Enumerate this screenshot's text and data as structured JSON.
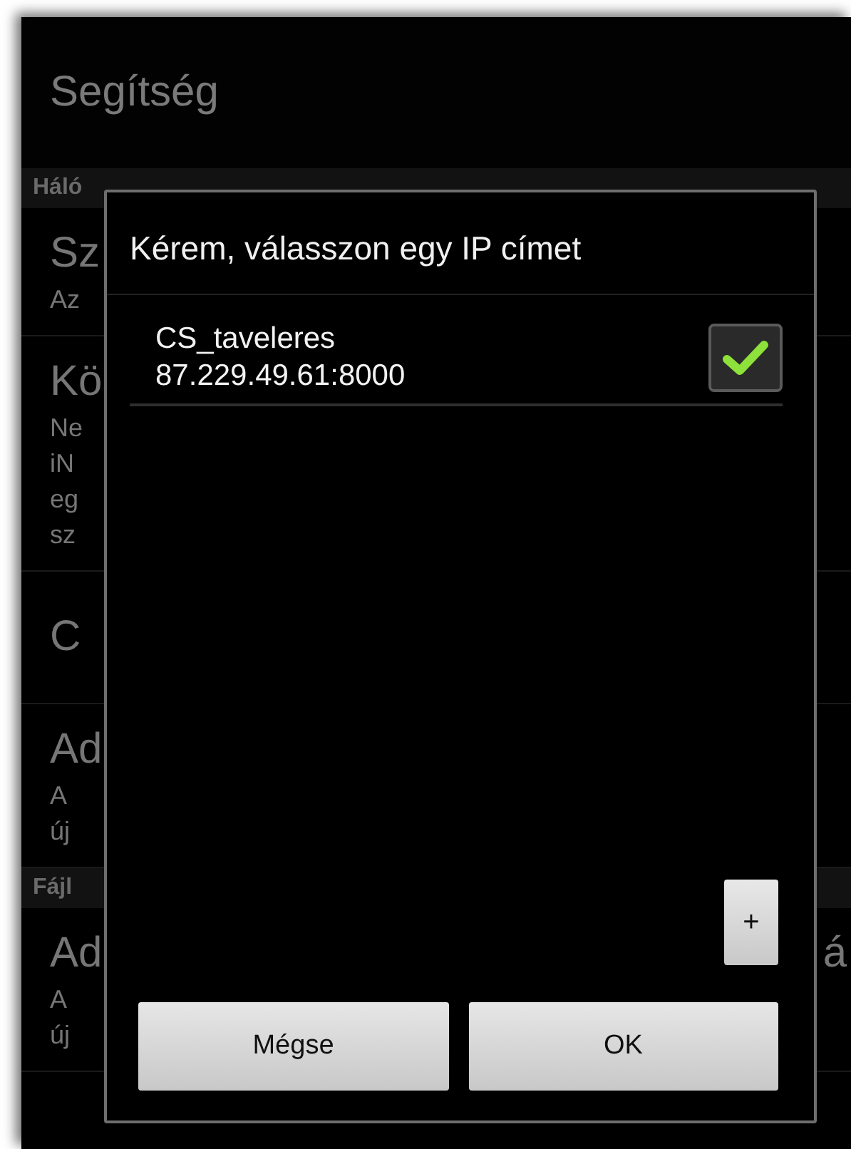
{
  "header": {
    "title": "Segítség"
  },
  "sections": [
    {
      "title": "Háló",
      "items": [
        {
          "title": "Sz",
          "summary": [
            "Az"
          ]
        },
        {
          "title": "Kö",
          "summary": [
            "Ne",
            "iN",
            "eg",
            "sz"
          ]
        },
        {
          "title": "C"
        },
        {
          "title": "Ad",
          "summary": [
            "A",
            "új"
          ]
        }
      ]
    },
    {
      "title": "Fájl",
      "items": [
        {
          "title": "Ad",
          "title_end": "á",
          "summary": [
            "A",
            "új"
          ]
        }
      ]
    }
  ],
  "dialog": {
    "title": "Kérem, válasszon egy IP címet",
    "options": [
      {
        "name": "CS_taveleres",
        "address": "87.229.49.61:8000",
        "checked": true
      }
    ],
    "add_button": "+",
    "buttons": [
      "Mégse",
      "OK"
    ]
  }
}
